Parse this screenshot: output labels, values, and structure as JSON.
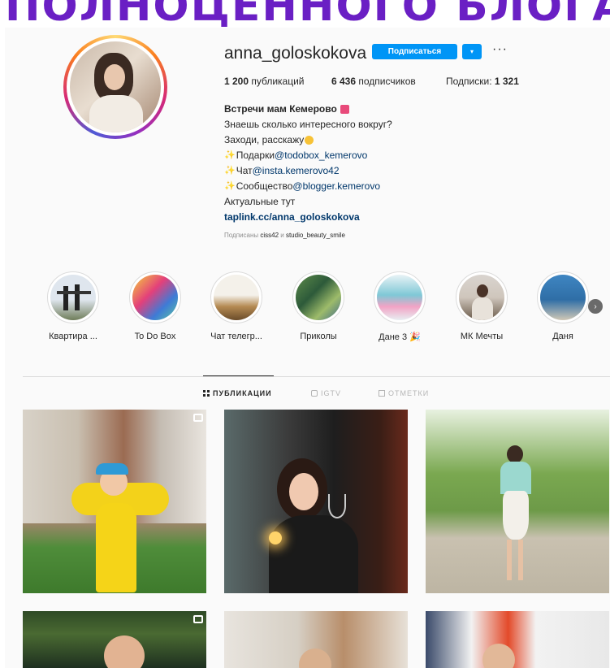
{
  "banner": {
    "text": "ПОЛНОЦЕННОГО БЛОГА"
  },
  "profile": {
    "username": "anna_goloskokova",
    "follow_label": "Подписаться",
    "dropdown_glyph": "▾",
    "more_glyph": "···"
  },
  "stats": {
    "posts_count": "1 200",
    "posts_label": "публикаций",
    "followers_count": "6 436",
    "followers_label": "подписчиков",
    "following_label": "Подписки:",
    "following_count": "1 321"
  },
  "bio": {
    "name": "Встречи мам Кемерово",
    "line1": "Знаешь сколько интересного вокруг?",
    "line2": "Заходи, расскажу",
    "gifts_label": "Подарки ",
    "gifts_link": "@todobox_kemerovo",
    "chat_label": "Чат ",
    "chat_link": "@insta.kemerovo42",
    "community_label": "Сообщество ",
    "community_link": "@blogger.kemerovo",
    "actual": "Актуальные тут",
    "website": "taplink.cc/anna_goloskokova"
  },
  "followed_by": {
    "prefix": "Подписаны ",
    "user1": "ciss42",
    "joiner": " и ",
    "user2": "studio_beauty_smile"
  },
  "highlights": [
    {
      "label": "Квартира ..."
    },
    {
      "label": "To Do Box"
    },
    {
      "label": "Чат телегр..."
    },
    {
      "label": "Приколы"
    },
    {
      "label": "Дане 3 🎉"
    },
    {
      "label": "МК Мечты"
    },
    {
      "label": "Даня"
    }
  ],
  "tabs": {
    "posts": "ПУБЛИКАЦИИ",
    "igtv": "IGTV",
    "tagged": "ОТМЕТКИ"
  },
  "colors": {
    "accent": "#0095f6",
    "link": "#00376b",
    "banner": "#6a1fc4"
  }
}
